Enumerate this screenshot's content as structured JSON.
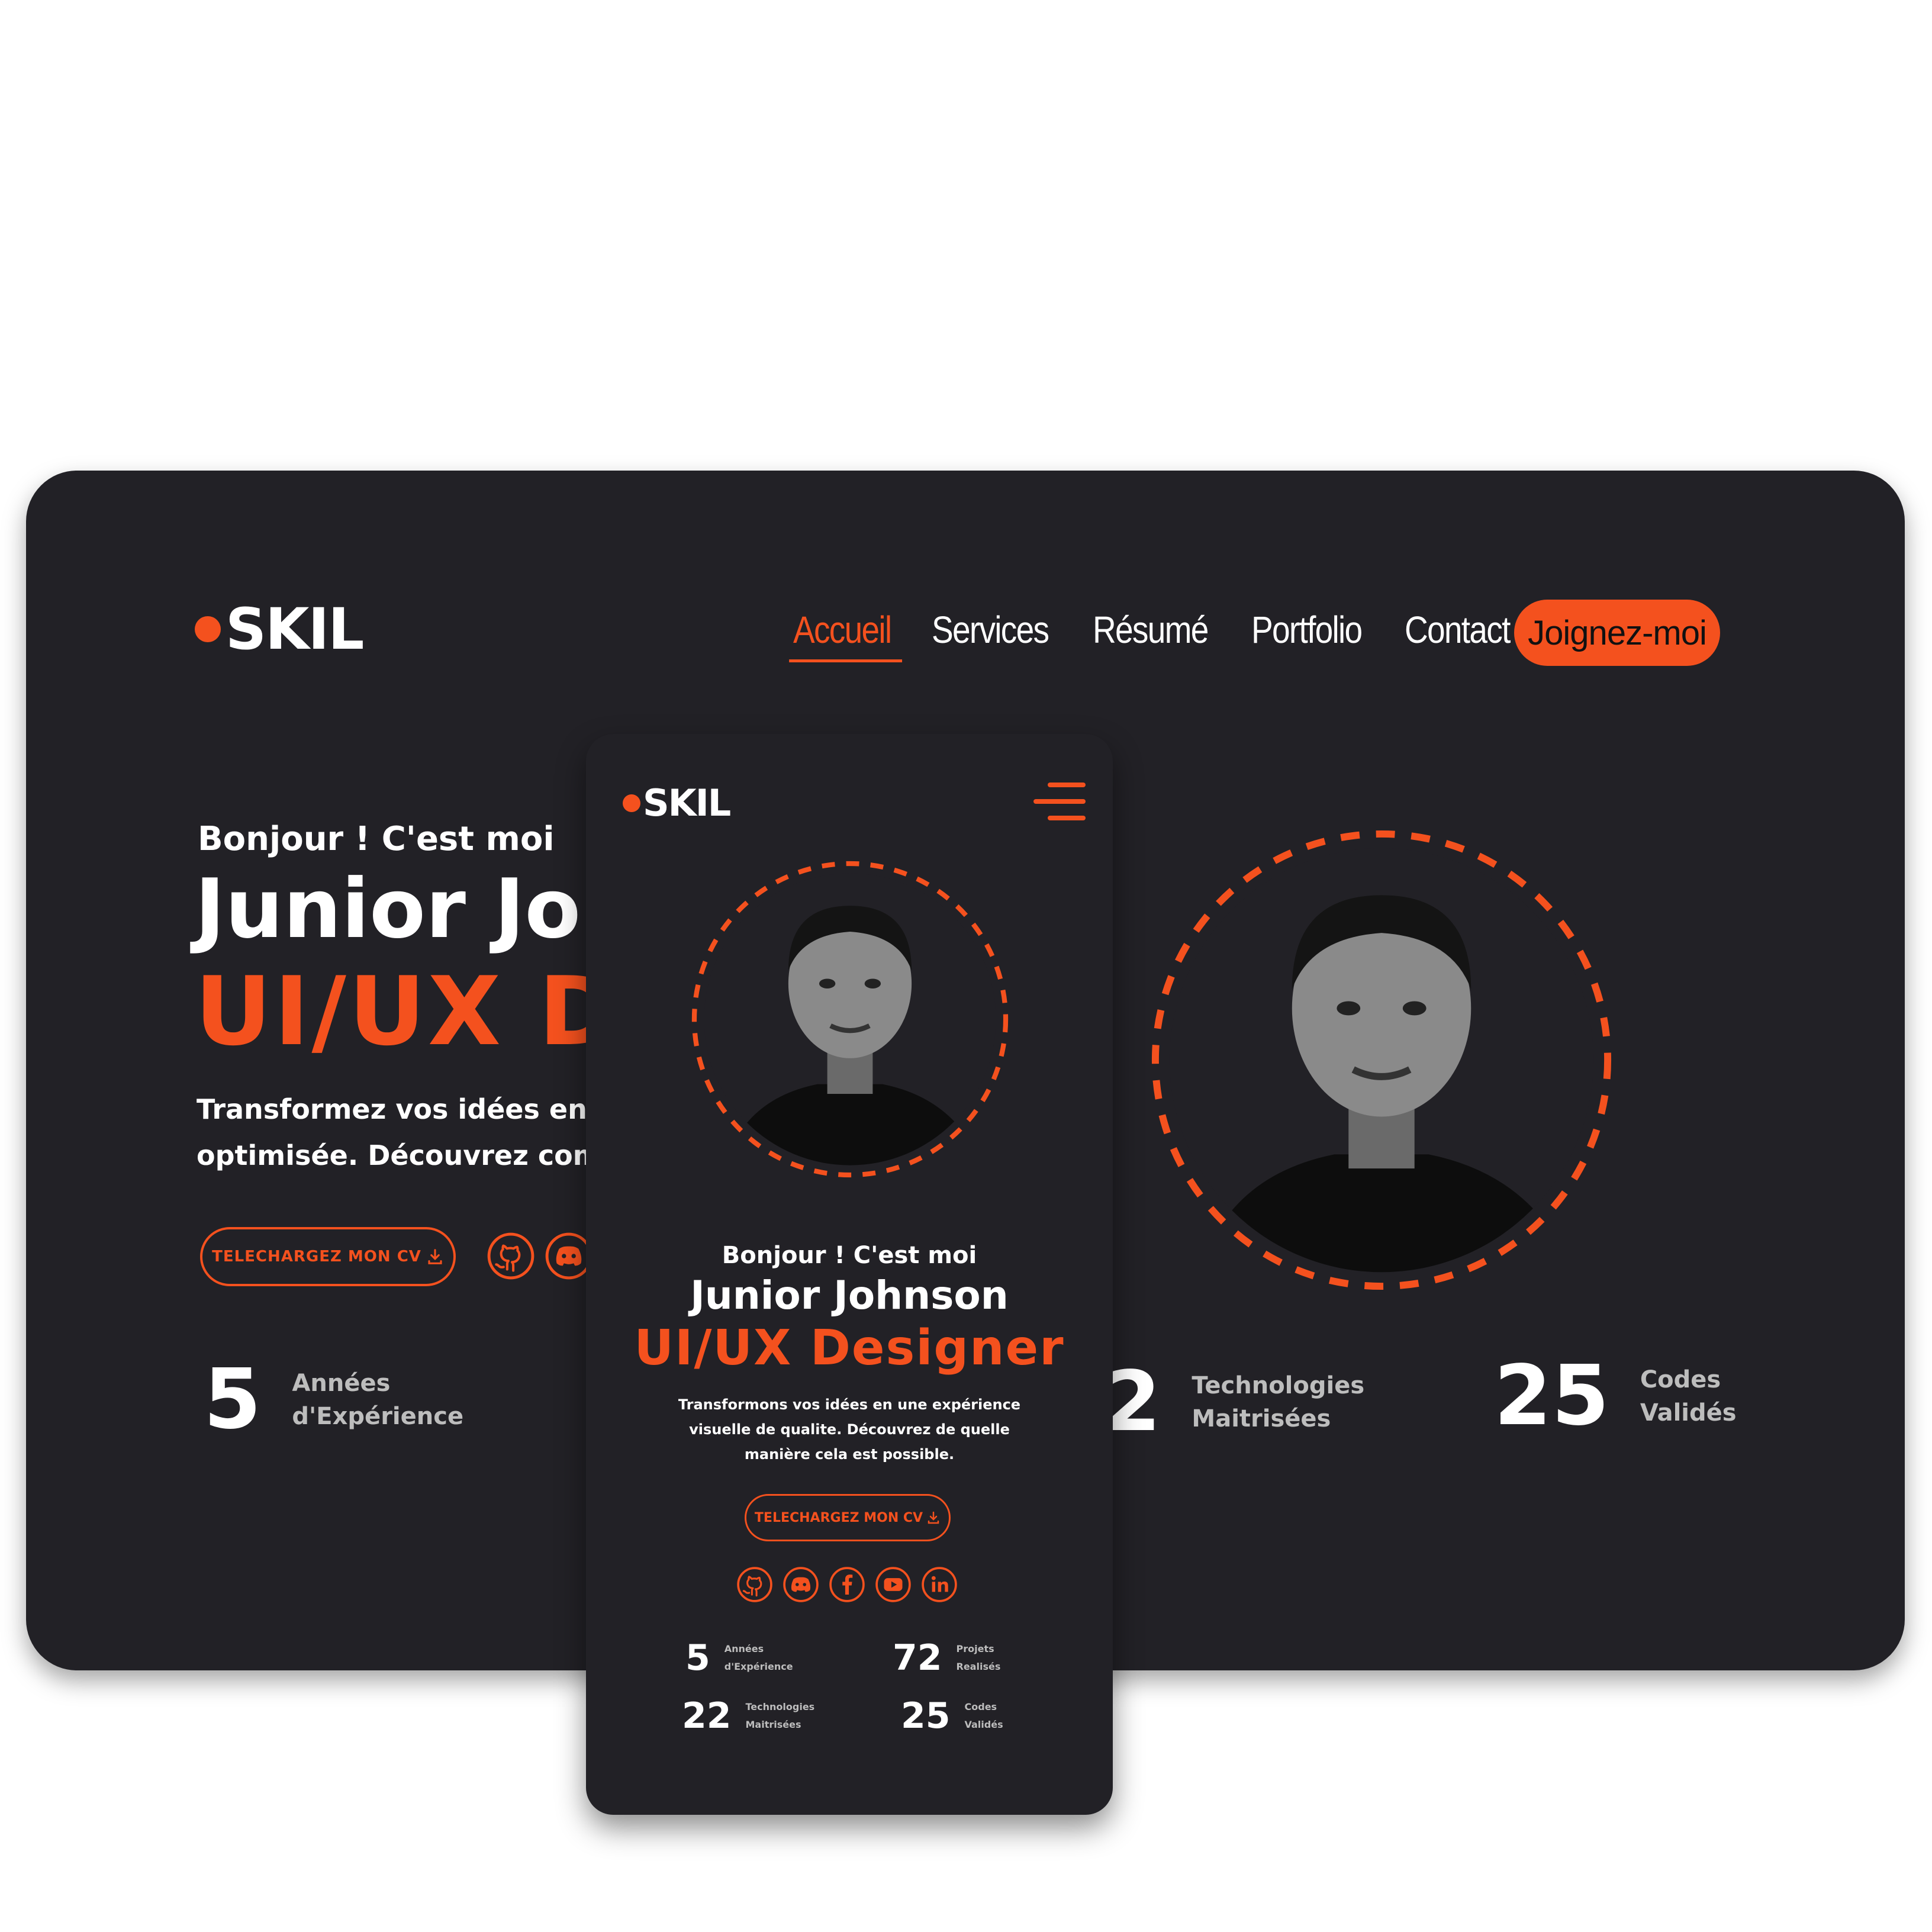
{
  "brand": {
    "name": "SKIL",
    "accent": "#f4511e",
    "bg": "#222126"
  },
  "nav": {
    "items": [
      {
        "label": "Accueil",
        "active": true
      },
      {
        "label": "Services"
      },
      {
        "label": "Résumé"
      },
      {
        "label": "Portfolio"
      },
      {
        "label": "Contact"
      }
    ],
    "cta": "Joignez-moi"
  },
  "desktop": {
    "hello": "Bonjour ! C'est moi",
    "name": "Junior Joh",
    "role": "UI/UX D",
    "desc_line1": "Transformez vos idées en une e",
    "desc_line2": "optimisée. Découvrez commen",
    "cv_button": "TELECHARGEZ MON CV",
    "socials": [
      "github-icon",
      "discord-icon"
    ],
    "stats": [
      {
        "num": "5",
        "l1": "Années",
        "l2": "d'Expérience"
      },
      {
        "num": "2",
        "l1": "Technologies",
        "l2": "Maitrisées"
      },
      {
        "num": "25",
        "l1": "Codes",
        "l2": "Validés"
      }
    ]
  },
  "mobile": {
    "hello": "Bonjour ! C'est moi",
    "name": "Junior Johnson",
    "role": "UI/UX Designer",
    "desc": "Transformons vos idées en une expérience visuelle de qualite. Découvrez de quelle manière cela est possible.",
    "cv_button": "TELECHARGEZ MON CV",
    "socials": [
      "github-icon",
      "discord-icon",
      "facebook-icon",
      "youtube-icon",
      "linkedin-icon"
    ],
    "stats": [
      {
        "num": "5",
        "l1": "Années",
        "l2": "d'Expérience"
      },
      {
        "num": "72",
        "l1": "Projets",
        "l2": "Realisés"
      },
      {
        "num": "22",
        "l1": "Technologies",
        "l2": "Maitrisées"
      },
      {
        "num": "25",
        "l1": "Codes",
        "l2": "Validés"
      }
    ]
  }
}
